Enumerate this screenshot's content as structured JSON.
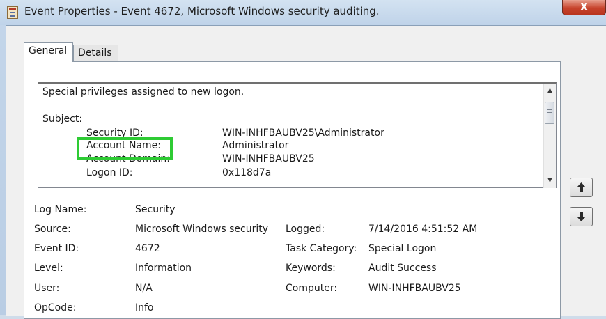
{
  "window": {
    "title": "Event Properties - Event 4672, Microsoft Windows security auditing.",
    "close_label": "X"
  },
  "tabs": [
    {
      "label": "General",
      "active": true
    },
    {
      "label": "Details",
      "active": false
    }
  ],
  "description": {
    "headline": "Special privileges assigned to new logon.",
    "subject_label": "Subject:",
    "rows": [
      {
        "label": "Security ID:",
        "value": "WIN-INHFBAUBV25\\Administrator"
      },
      {
        "label": "Account Name:",
        "value": "Administrator"
      },
      {
        "label": "Account Domain:",
        "value": "WIN-INHFBAUBV25"
      },
      {
        "label": "Logon ID:",
        "value": "0x118d7a"
      }
    ]
  },
  "fields": {
    "log_name": {
      "label": "Log Name:",
      "value": "Security"
    },
    "source": {
      "label": "Source:",
      "value": "Microsoft Windows security"
    },
    "logged": {
      "label": "Logged:",
      "value": "7/14/2016 4:51:52 AM"
    },
    "event_id": {
      "label": "Event ID:",
      "value": "4672"
    },
    "task_category": {
      "label": "Task Category:",
      "value": "Special Logon"
    },
    "level": {
      "label": "Level:",
      "value": "Information"
    },
    "keywords": {
      "label": "Keywords:",
      "value": "Audit Success"
    },
    "user": {
      "label": "User:",
      "value": "N/A"
    },
    "computer": {
      "label": "Computer:",
      "value": "WIN-INHFBAUBV25"
    },
    "opcode": {
      "label": "OpCode:",
      "value": "Info"
    }
  },
  "icons": {
    "title": "event-viewer-icon",
    "up": "arrow-up-icon",
    "down": "arrow-down-icon"
  },
  "colors": {
    "highlight": "#2ecb34",
    "close_button": "#c7432c"
  }
}
